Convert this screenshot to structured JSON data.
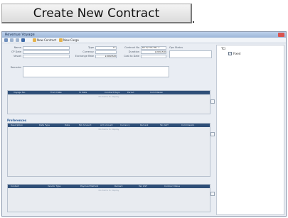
{
  "top_button": {
    "label": "Create New Contract"
  },
  "window": {
    "title": "Revenue Voyage",
    "toolbar": {
      "new_contract_label": "New Contract",
      "new_cargo_label": "New Cargo"
    }
  },
  "form": {
    "labels": {
      "name": "Name",
      "cp_date": "CP Date",
      "vessel": "Vessel",
      "type": "Type",
      "currency": "Currency",
      "exchange_rate": "Exchange Rate",
      "contract_no": "Contract No",
      "duration": "Duration",
      "cost_to_date": "Cost to Date",
      "ops_status": "Ops Status",
      "remarks": "Remarks"
    },
    "values": {
      "type": "TC",
      "contract_no": "8752700 RC 1",
      "duration": "1000000",
      "exchange_rate": "1000000"
    }
  },
  "grid_one": {
    "columns": [
      "Voyage No.",
      "From Date",
      "To Date",
      "Contract Days",
      "Period",
      "Commission"
    ],
    "empty_text": "No items to display"
  },
  "preferences": {
    "title": "Preferences",
    "columns": [
      "Description",
      "Date Type",
      "Date",
      "Est Amount",
      "Act Amount",
      "Currency",
      "Remark",
      "Tax GST",
      "Commission"
    ],
    "empty_text": "No items to display"
  },
  "grid_three": {
    "columns": [
      "Contact",
      "Vendor Type",
      "Payment Method",
      "Remark",
      "Tax GST",
      "Contract Value"
    ],
    "empty_text": "No items to display"
  },
  "side": {
    "header": "TCI",
    "checkbox_label": "Fixed"
  }
}
